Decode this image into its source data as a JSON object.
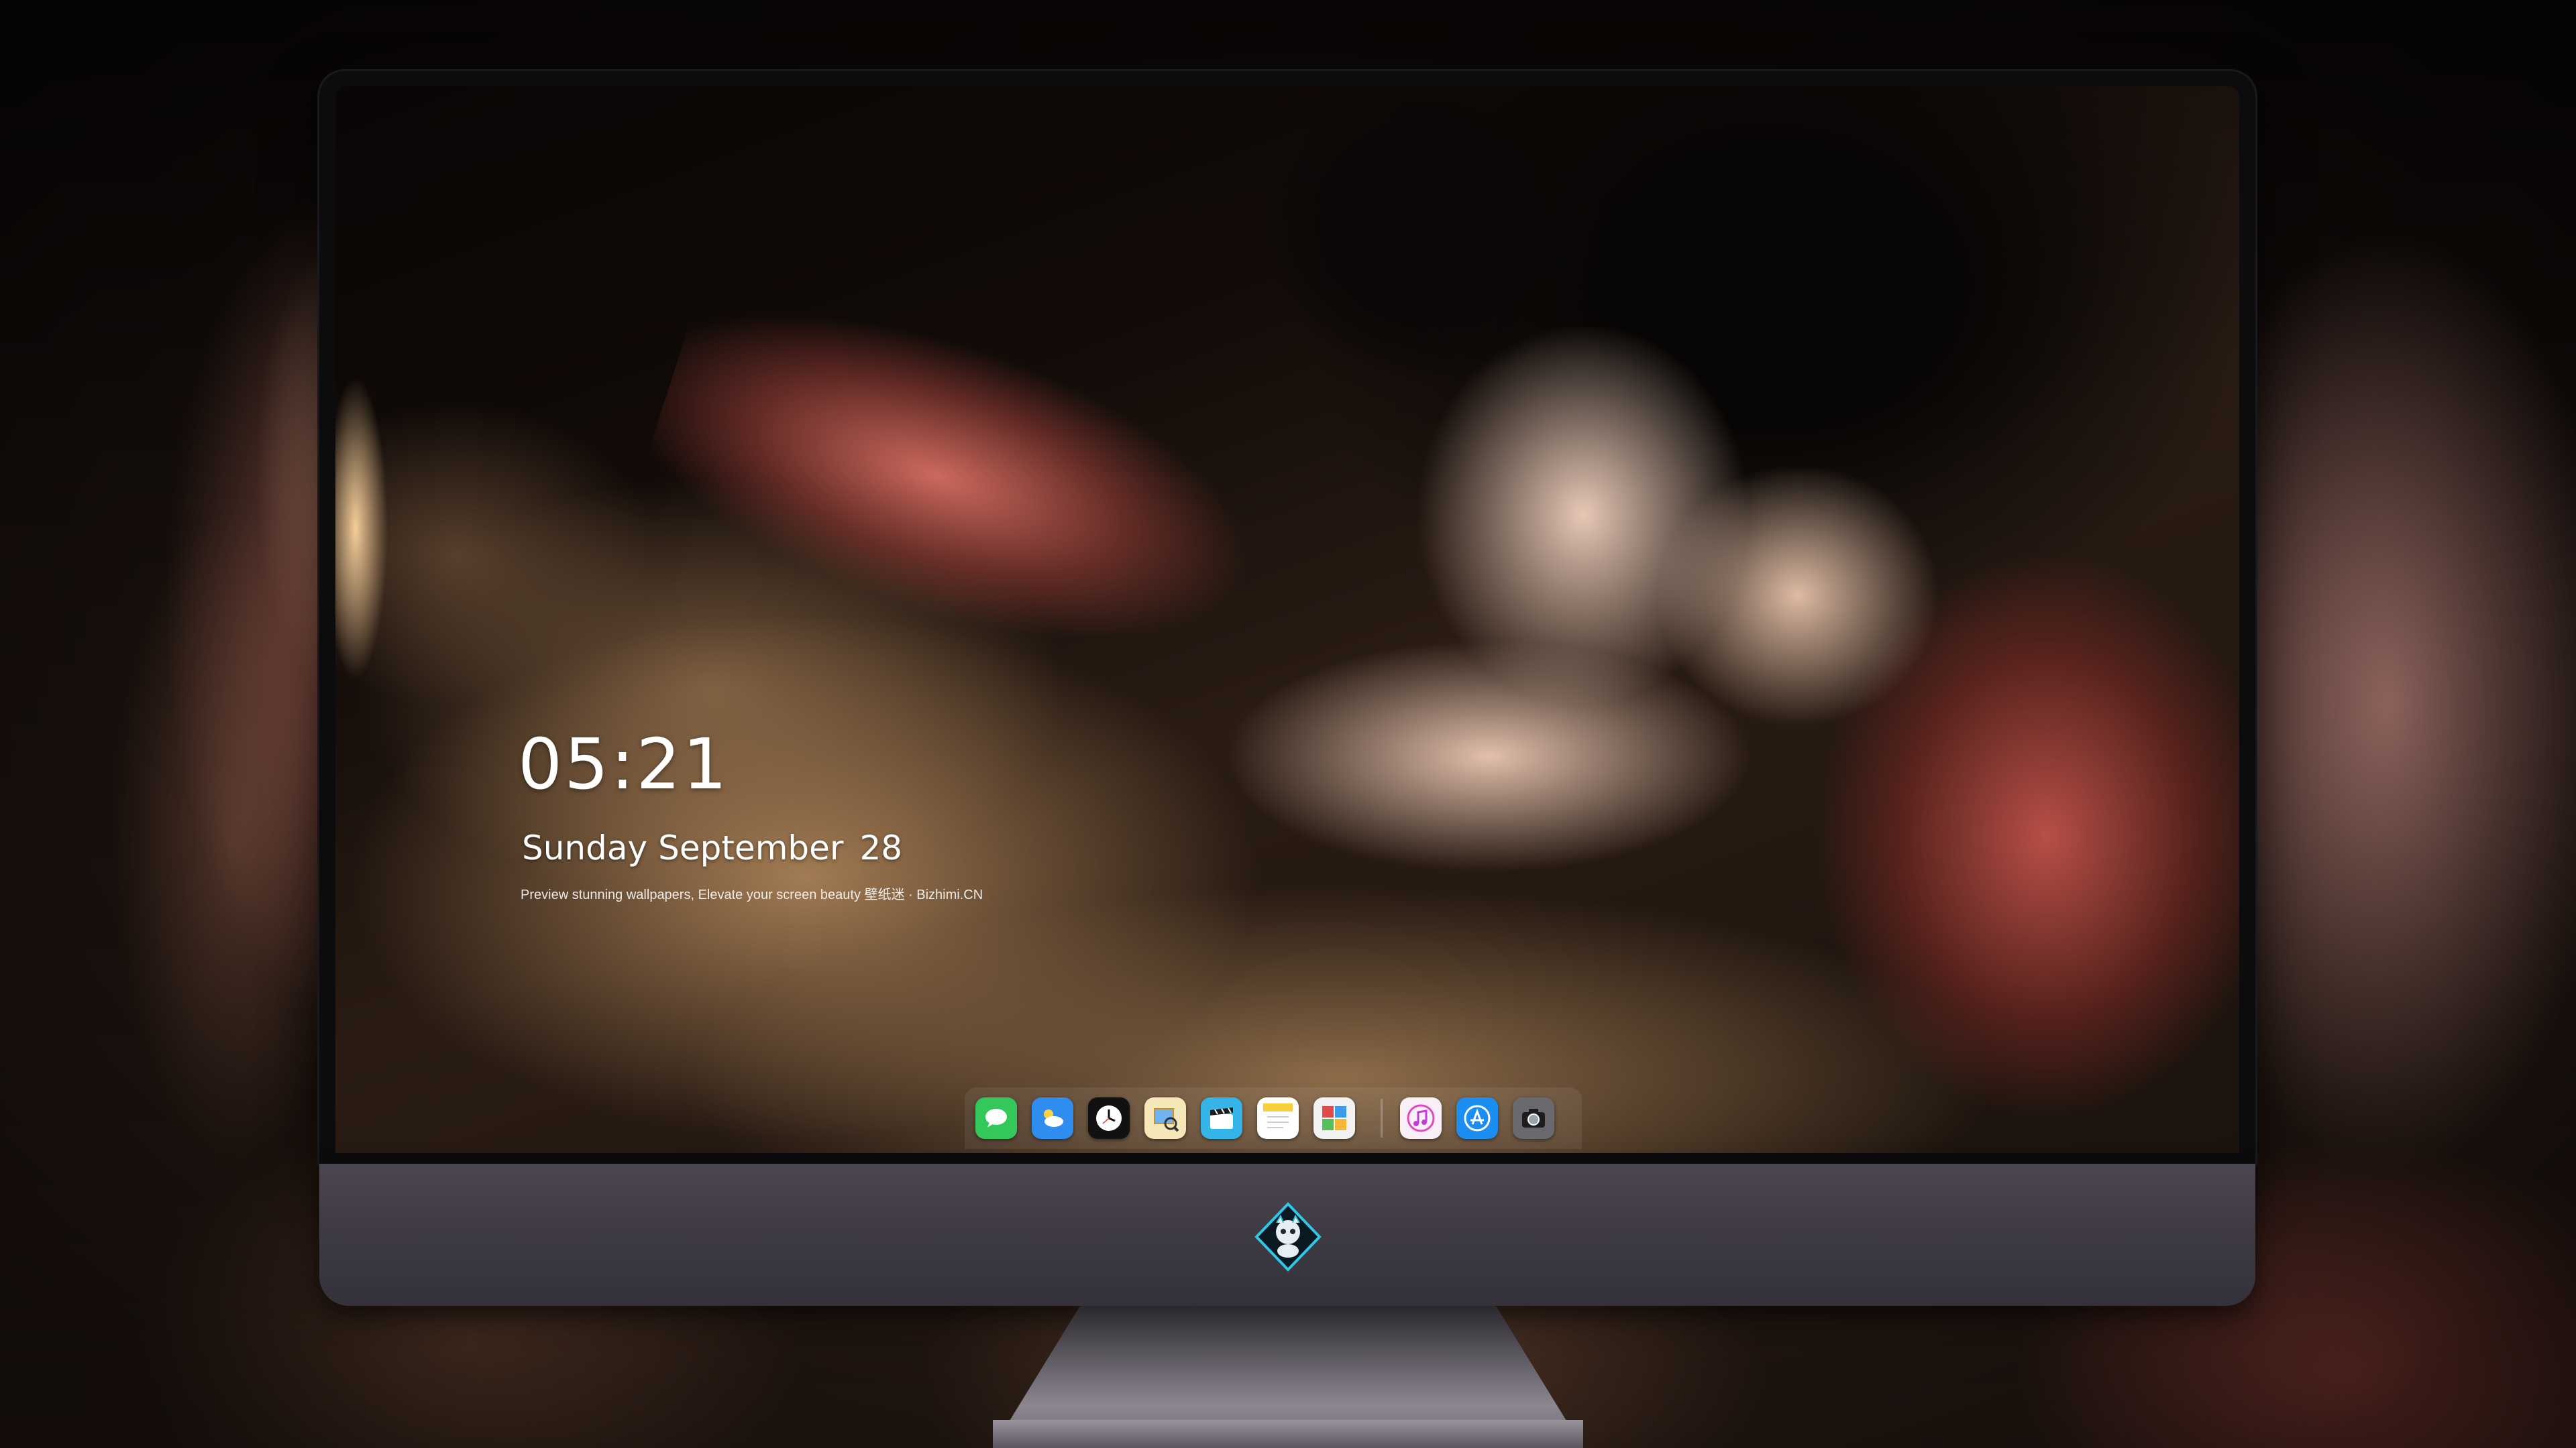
{
  "lock_screen": {
    "time": "05:21",
    "weekday": "Sunday",
    "month": "September",
    "day": "28",
    "tagline": "Preview stunning wallpapers, Elevate your screen beauty 壁纸迷 · Bizhimi.CN"
  },
  "dock": {
    "apps": [
      {
        "name": "messages-icon",
        "color": "#34c759"
      },
      {
        "name": "weather-icon",
        "color": "#2f8df0"
      },
      {
        "name": "clock-icon",
        "color": "#111111"
      },
      {
        "name": "preview-icon",
        "color": "#f4b73a"
      },
      {
        "name": "clips-icon",
        "color": "#35b4e8"
      },
      {
        "name": "notes-icon",
        "color": "#f7cf3c"
      },
      {
        "name": "photo-booth-icon",
        "color": "#e14a4a"
      }
    ],
    "pinned": [
      {
        "name": "music-icon",
        "color": "#e24bbf"
      },
      {
        "name": "app-store-icon",
        "color": "#1c8ef2"
      },
      {
        "name": "camera-icon",
        "color": "#6a6a6e"
      }
    ]
  },
  "colors": {
    "bezel": "#0c0c0e",
    "chin": "#3d3942",
    "lock_text": "#ffffff"
  }
}
